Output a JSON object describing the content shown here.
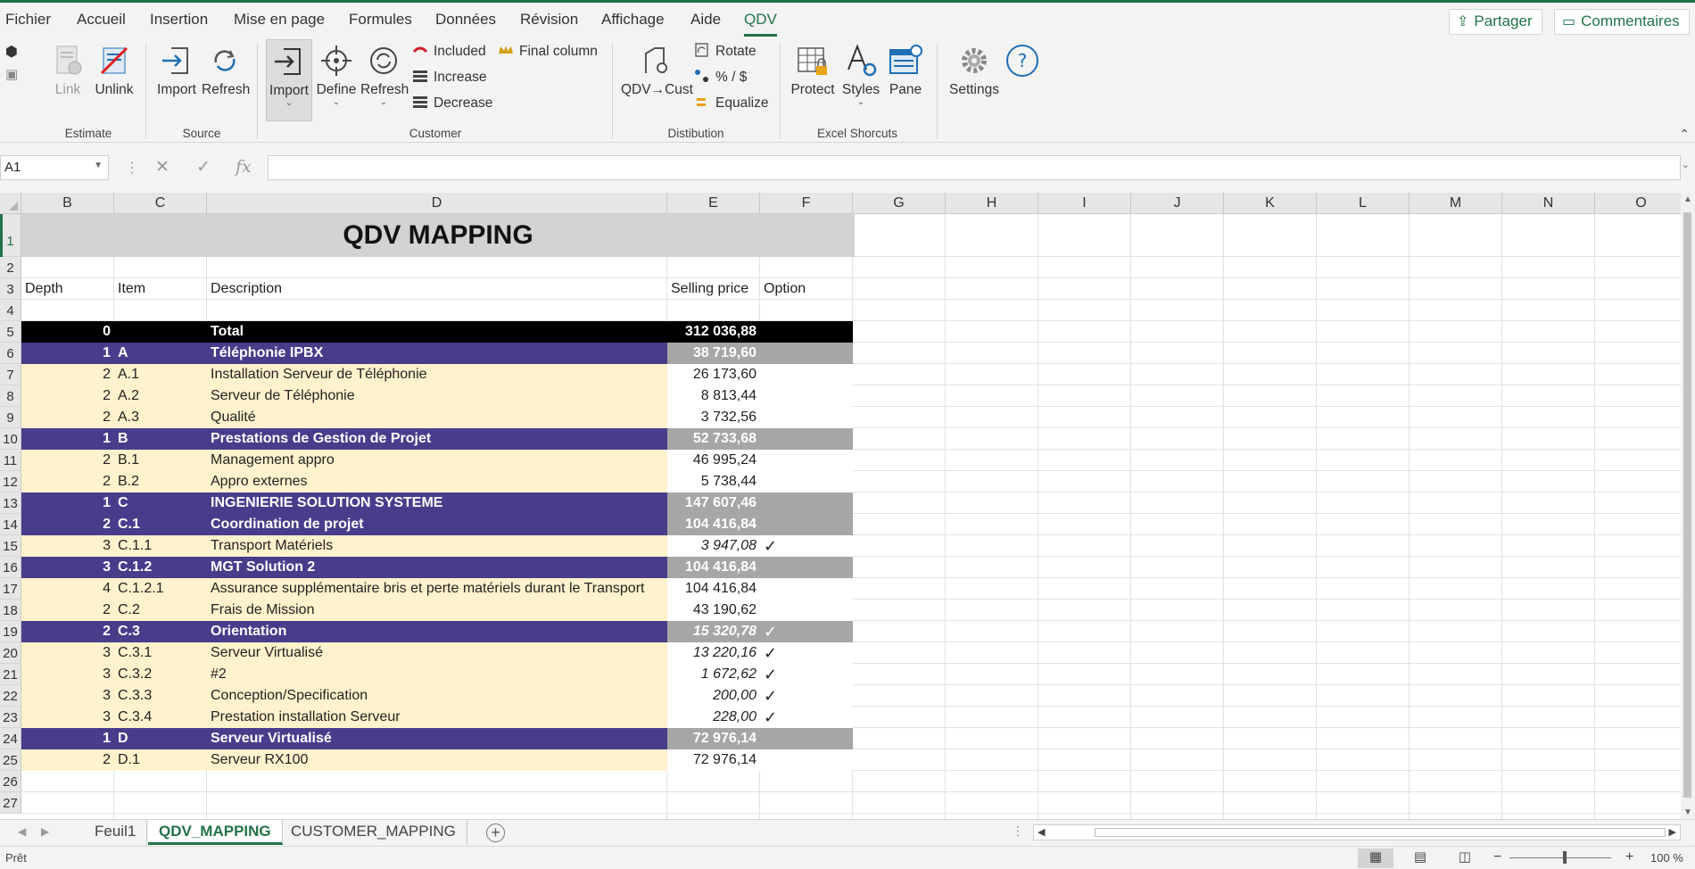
{
  "menu": {
    "items": [
      "Fichier",
      "Accueil",
      "Insertion",
      "Mise en page",
      "Formules",
      "Données",
      "Révision",
      "Affichage",
      "Aide",
      "QDV"
    ],
    "active": "QDV",
    "share_label": "Partager",
    "comments_label": "Commentaires"
  },
  "ribbon": {
    "estimate": {
      "label": "Estimate",
      "link": "Link",
      "unlink": "Unlink"
    },
    "source": {
      "label": "Source",
      "import": "Import",
      "refresh": "Refresh"
    },
    "customer": {
      "label": "Customer",
      "import": "Import",
      "define": "Define",
      "refresh": "Refresh",
      "included": "Included",
      "increase": "Increase",
      "decrease": "Decrease",
      "final_column": "Final column"
    },
    "distribution": {
      "label": "Distibution",
      "qdv_cust": "QDV→Cust",
      "rotate": "Rotate",
      "percent_dollar": "% / $",
      "equalize": "Equalize"
    },
    "excel": {
      "label": "Excel Shorcuts",
      "protect": "Protect",
      "styles": "Styles",
      "pane": "Pane"
    },
    "settings": {
      "label": "Settings"
    },
    "colors": {
      "accent": "#217346",
      "icon_blue": "#1f6fb5",
      "unlink_red": "#e02020",
      "gold": "#d4a017"
    }
  },
  "formula_bar": {
    "name_box": "A1",
    "formula": ""
  },
  "grid": {
    "columns": [
      "B",
      "C",
      "D",
      "E",
      "F",
      "G",
      "H",
      "I",
      "J",
      "K",
      "L",
      "M",
      "N",
      "O"
    ],
    "rows": [
      "1",
      "2",
      "3",
      "4",
      "5",
      "6",
      "7",
      "8",
      "9",
      "10",
      "11",
      "12",
      "13",
      "14",
      "15",
      "16",
      "17",
      "18",
      "19",
      "20",
      "21",
      "22",
      "23",
      "24",
      "25",
      "26",
      "27"
    ],
    "title": "QDV MAPPING",
    "headers": {
      "depth": "Depth",
      "item": "Item",
      "description": "Description",
      "price": "Selling price",
      "option": "Option"
    },
    "colors": {
      "total_bg": "#000000",
      "group_bg": "#483d8b",
      "group_price_bg": "#a6a6a6",
      "leaf_bg": "#fff2cc",
      "title_bg": "#d3d3d3"
    },
    "data_rows": [
      {
        "depth": "0",
        "item": "",
        "description": "Total",
        "price": "312 036,88",
        "option": "",
        "style": "total"
      },
      {
        "depth": "1",
        "item": "A",
        "description": "Téléphonie IPBX",
        "price": "38 719,60",
        "option": "",
        "style": "group"
      },
      {
        "depth": "2",
        "item": "A.1",
        "description": "Installation Serveur de Téléphonie",
        "price": "26 173,60",
        "option": "",
        "style": "leaf"
      },
      {
        "depth": "2",
        "item": "A.2",
        "description": "Serveur de Téléphonie",
        "price": "8 813,44",
        "option": "",
        "style": "leaf"
      },
      {
        "depth": "2",
        "item": "A.3",
        "description": "Qualité",
        "price": "3 732,56",
        "option": "",
        "style": "leaf"
      },
      {
        "depth": "1",
        "item": "B",
        "description": "Prestations de Gestion de Projet",
        "price": "52 733,68",
        "option": "",
        "style": "group"
      },
      {
        "depth": "2",
        "item": "B.1",
        "description": "Management appro",
        "price": "46 995,24",
        "option": "",
        "style": "leaf"
      },
      {
        "depth": "2",
        "item": "B.2",
        "description": "Appro externes",
        "price": "5 738,44",
        "option": "",
        "style": "leaf"
      },
      {
        "depth": "1",
        "item": "C",
        "description": "INGENIERIE SOLUTION SYSTEME",
        "price": "147 607,46",
        "option": "",
        "style": "group"
      },
      {
        "depth": "2",
        "item": "C.1",
        "description": "Coordination de projet",
        "price": "104 416,84",
        "option": "",
        "style": "group"
      },
      {
        "depth": "3",
        "item": "C.1.1",
        "description": "Transport Matériels",
        "price": "3 947,08",
        "option": "✓",
        "style": "leaf",
        "italic": true
      },
      {
        "depth": "3",
        "item": "C.1.2",
        "description": "MGT Solution 2",
        "price": "104 416,84",
        "option": "",
        "style": "group"
      },
      {
        "depth": "4",
        "item": "C.1.2.1",
        "description": "Assurance supplémentaire bris et perte matériels durant le Transport",
        "price": "104 416,84",
        "option": "",
        "style": "leaf"
      },
      {
        "depth": "2",
        "item": "C.2",
        "description": "Frais de Mission",
        "price": "43 190,62",
        "option": "",
        "style": "leaf"
      },
      {
        "depth": "2",
        "item": "C.3",
        "description": "Orientation",
        "price": "15 320,78",
        "option": "✓",
        "style": "group",
        "italic": true
      },
      {
        "depth": "3",
        "item": "C.3.1",
        "description": "Serveur Virtualisé",
        "price": "13 220,16",
        "option": "✓",
        "style": "leaf",
        "italic": true
      },
      {
        "depth": "3",
        "item": "C.3.2",
        "description": "#2",
        "price": "1 672,62",
        "option": "✓",
        "style": "leaf",
        "italic": true
      },
      {
        "depth": "3",
        "item": "C.3.3",
        "description": "Conception/Specification",
        "price": "200,00",
        "option": "✓",
        "style": "leaf",
        "italic": true
      },
      {
        "depth": "3",
        "item": "C.3.4",
        "description": "Prestation installation Serveur",
        "price": "228,00",
        "option": "✓",
        "style": "leaf",
        "italic": true
      },
      {
        "depth": "1",
        "item": "D",
        "description": "Serveur Virtualisé",
        "price": "72 976,14",
        "option": "",
        "style": "group"
      },
      {
        "depth": "2",
        "item": "D.1",
        "description": "Serveur RX100",
        "price": "72 976,14",
        "option": "",
        "style": "leaf"
      }
    ]
  },
  "sheets": {
    "tabs": [
      "Feuil1",
      "QDV_MAPPING",
      "CUSTOMER_MAPPING"
    ],
    "active": "QDV_MAPPING"
  },
  "status": {
    "text": "Prêt",
    "zoom": "100 %"
  }
}
